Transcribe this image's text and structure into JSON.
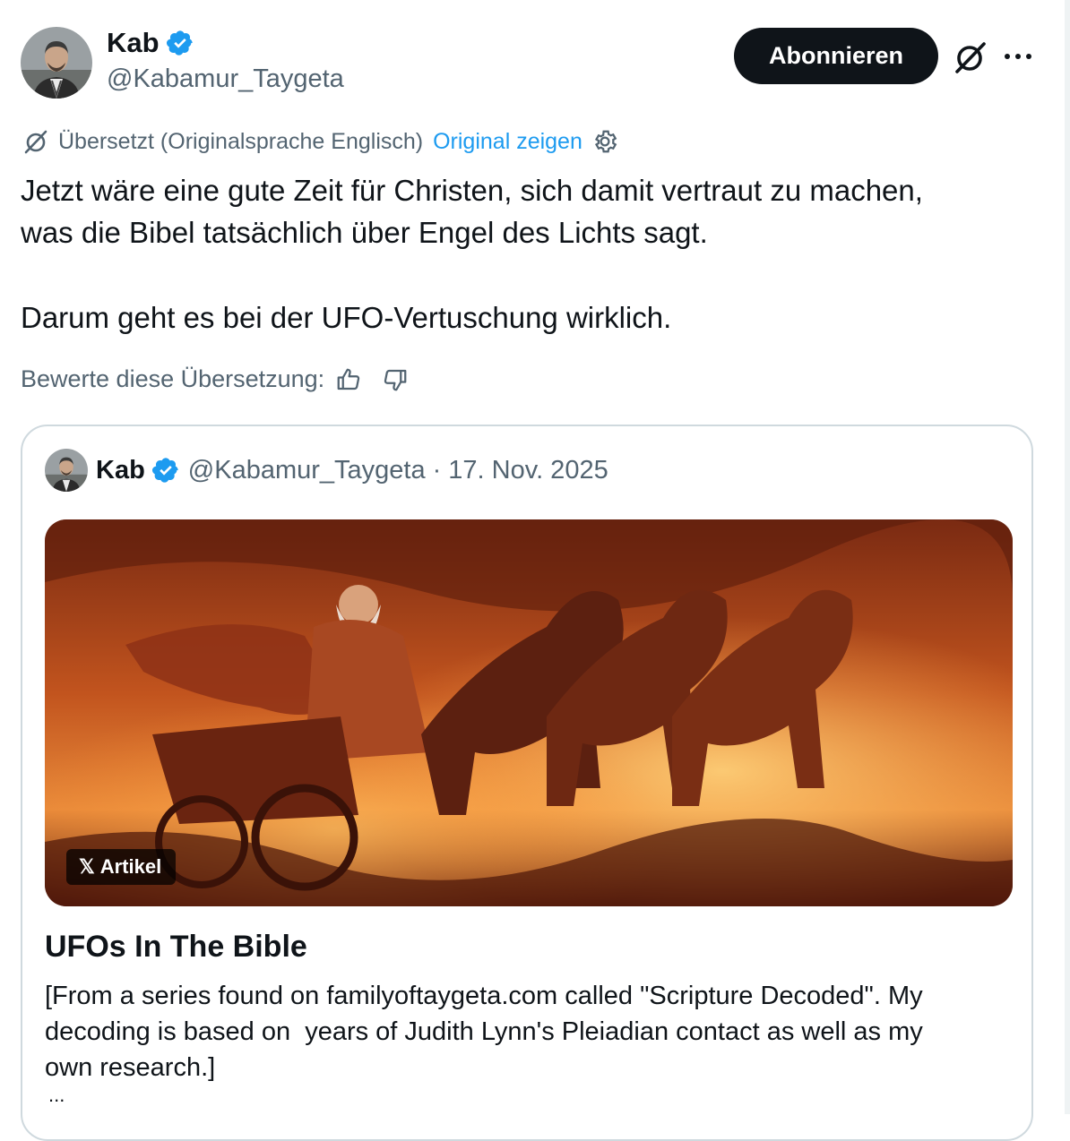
{
  "author": {
    "display_name": "Kab",
    "handle": "@Kabamur_Taygeta",
    "verified": true
  },
  "actions": {
    "follow_label": "Abonnieren",
    "grok_icon": "grok-icon",
    "more_icon": "more-icon"
  },
  "translation": {
    "notice": "Übersetzt (Originalsprache Englisch)",
    "show_original": "Original zeigen",
    "rate_label": "Bewerte diese Übersetzung:"
  },
  "tweet": {
    "line1": "Jetzt wäre eine gute Zeit für Christen, sich damit vertraut zu machen,",
    "line2": "was die Bibel tatsächlich über Engel des Lichts sagt.",
    "line3": "Darum geht es bei der UFO-Vertuschung wirklich."
  },
  "quote": {
    "display_name": "Kab",
    "handle": "@Kabamur_Taygeta",
    "separator": "·",
    "date": "17. Nov. 2025",
    "badge_label": "Artikel",
    "badge_logo": "𝕏",
    "title": "UFOs In The Bible",
    "summary": "[From a series found on familyoftaygeta.com called \"Scripture Decoded\". My\ndecoding is based on  years of Judith Lynn's Pleiadian contact as well as my\nown research.]",
    "ellipsis": "..."
  },
  "colors": {
    "text": "#0f1419",
    "secondary": "#536471",
    "link": "#1d9bf0",
    "verified": "#1d9bf0",
    "border": "#cfd9de"
  }
}
